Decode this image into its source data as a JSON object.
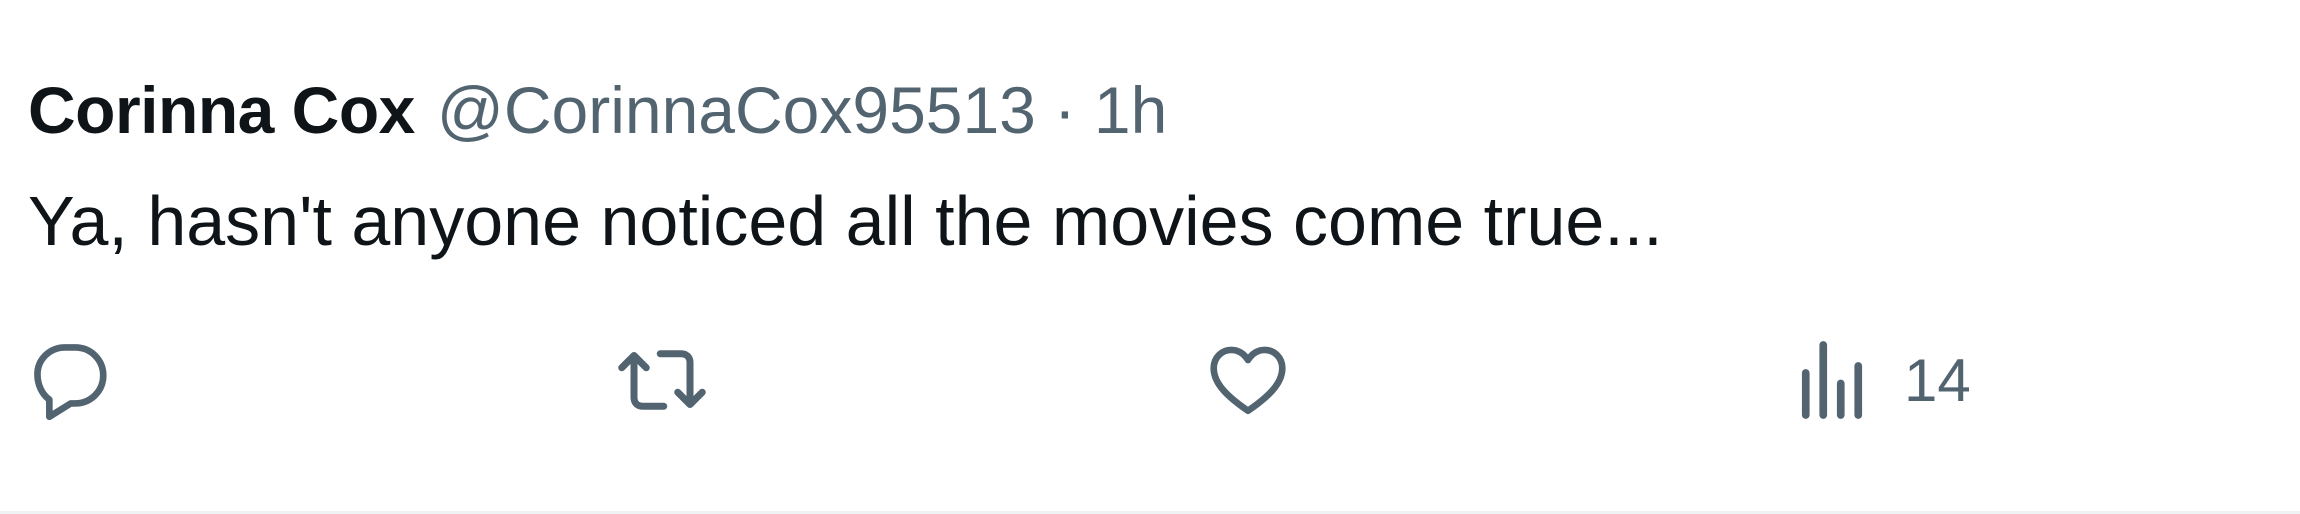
{
  "tweet": {
    "author": {
      "display_name": "Corinna Cox",
      "handle": "@CorinnaCox95513",
      "separator": "·",
      "time": "1h"
    },
    "text": "Ya, hasn't anyone noticed all the movies come true...",
    "actions": {
      "reply": {
        "icon": "reply-icon"
      },
      "retweet": {
        "icon": "retweet-icon"
      },
      "like": {
        "icon": "heart-icon"
      },
      "views": {
        "icon": "views-chart-icon",
        "count": "14"
      }
    }
  },
  "colors": {
    "primary_text": "#0f1419",
    "secondary_text": "#536471",
    "divider": "#eff3f4"
  }
}
